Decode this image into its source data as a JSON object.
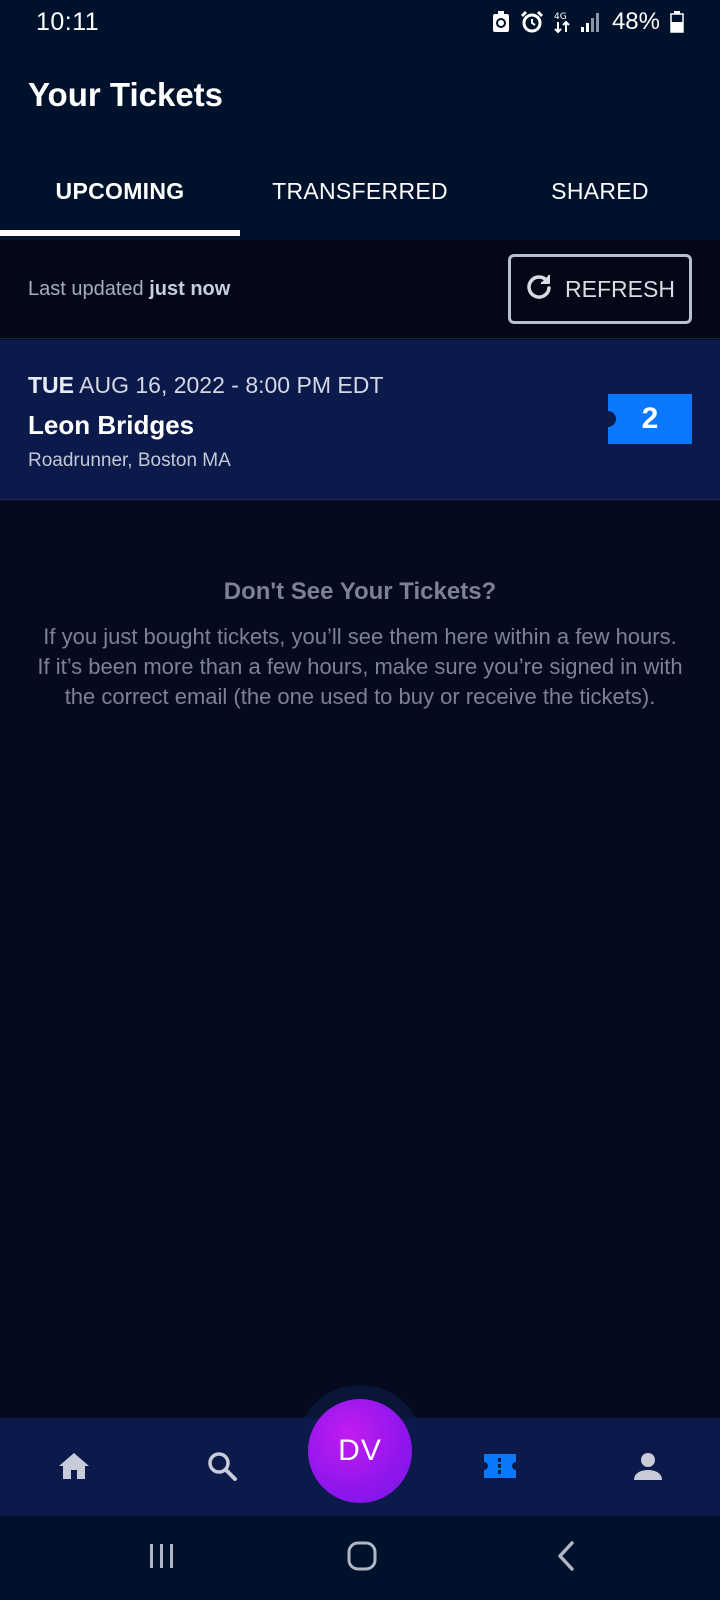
{
  "status_bar": {
    "time": "10:11",
    "battery": "48%",
    "icons": [
      "recycle-icon",
      "alarm-icon",
      "data-transfer-icon",
      "signal-icon",
      "battery-icon"
    ]
  },
  "header": {
    "title": "Your Tickets",
    "tabs": [
      {
        "label": "UPCOMING",
        "active": true
      },
      {
        "label": "TRANSFERRED",
        "active": false
      },
      {
        "label": "SHARED",
        "active": false
      }
    ]
  },
  "update_bar": {
    "prefix": "Last updated",
    "value": "just now",
    "refresh_label": "REFRESH",
    "refresh_icon": "refresh-icon"
  },
  "events": [
    {
      "day": "TUE",
      "datetime": "AUG 16, 2022 - 8:00 PM EDT",
      "name": "Leon Bridges",
      "venue": "Roadrunner, Boston MA",
      "ticket_count": "2"
    }
  ],
  "info": {
    "title": "Don't See Your Tickets?",
    "body": "If you just bought tickets, you’ll see them here within a few hours. If it’s been more than a few hours, make sure you’re signed in with the correct email (the one used to buy or receive the tickets)."
  },
  "bottom_nav": {
    "items": [
      {
        "name": "home",
        "icon": "home-icon"
      },
      {
        "name": "search",
        "icon": "search-icon"
      },
      {
        "name": "tickets",
        "icon": "ticket-icon",
        "active": true
      },
      {
        "name": "account",
        "icon": "person-icon"
      }
    ],
    "avatar_initials": "DV"
  },
  "colors": {
    "background": "#050a1e",
    "header": "#00112b",
    "card": "#0b1a4a",
    "accent_blue": "#0a79ff",
    "avatar_purple": "#9a17ee",
    "muted_text": "#7c8294"
  }
}
